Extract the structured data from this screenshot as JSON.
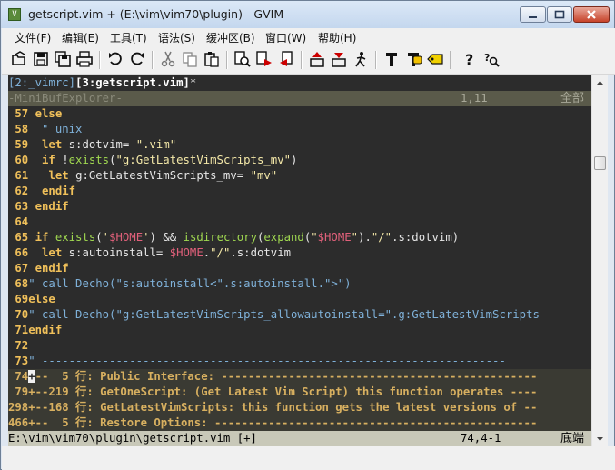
{
  "window": {
    "title": "getscript.vim + (E:\\vim\\vim70\\plugin) - GVIM",
    "app_icon": "vim-icon",
    "controls": [
      "minimize-icon",
      "maximize-icon",
      "close-icon"
    ]
  },
  "menu": [
    "文件(F)",
    "编辑(E)",
    "工具(T)",
    "语法(S)",
    "缓冲区(B)",
    "窗口(W)",
    "帮助(H)"
  ],
  "toolbar": {
    "icons": [
      "open-icon",
      "save-icon",
      "save-all-icon",
      "print-icon",
      "undo-icon",
      "redo-icon",
      "cut-icon",
      "copy-icon",
      "paste-icon",
      "find-replace-icon",
      "find-next-icon",
      "find-prev-icon",
      "load-session-icon",
      "save-session-icon",
      "run-script-icon",
      "make-icon",
      "run-shell-icon",
      "tag-jump-icon",
      "help-icon",
      "find-help-icon"
    ]
  },
  "minibuf": {
    "tab1": "[2:_vimrc]",
    "tab2": "[3:getscript.vim]",
    "modified": "*",
    "label": "-MiniBufExplorer-",
    "position": "1,11",
    "percent": "全部"
  },
  "lines": [
    {
      "n": "57",
      "text": " else"
    },
    {
      "n": "58",
      "text": "  \" unix"
    },
    {
      "n": "59",
      "text": "  let s:dotvim= \".vim\""
    },
    {
      "n": "60",
      "text": "  if !exists(\"g:GetLatestVimScripts_mv\")"
    },
    {
      "n": "61",
      "text": "   let g:GetLatestVimScripts_mv= \"mv\""
    },
    {
      "n": "62",
      "text": "  endif"
    },
    {
      "n": "63",
      "text": " endif"
    },
    {
      "n": "64",
      "text": ""
    },
    {
      "n": "65",
      "text": " if exists('$HOME') && isdirectory(expand(\"$HOME\").\"/\".s:dotvim)"
    },
    {
      "n": "66",
      "text": "  let s:autoinstall= $HOME.\"/\".s:dotvim"
    },
    {
      "n": "67",
      "text": " endif"
    },
    {
      "n": "68",
      "text": "\" call Decho(\"s:autoinstall<\".s:autoinstall.\">\")"
    },
    {
      "n": "69",
      "text": "else"
    },
    {
      "n": "70",
      "text": "\" call Decho(\"g:GetLatestVimScripts_allowautoinstall=\".g:GetLatestVimScripts"
    },
    {
      "n": "71",
      "text": "endif"
    },
    {
      "n": "72",
      "text": ""
    },
    {
      "n": "73",
      "text": "\" ---------------------------------------------------------------------"
    }
  ],
  "folds": [
    {
      "n": "74",
      "text": "+--  5 行: Public Interface: -----------------------------------------------"
    },
    {
      "n": "79",
      "text": "+--219 行: GetOneScript: (Get Latest Vim Script) this function operates ----"
    },
    {
      "n": "298",
      "text": "+--168 行: GetLatestVimScripts: this function gets the latest versions of --"
    },
    {
      "n": "466",
      "text": "+--  5 行: Restore Options: ------------------------------------------------"
    }
  ],
  "status": {
    "file": "E:\\vim\\vim70\\plugin\\getscript.vim [+]",
    "position": "74,4-1",
    "percent": "底端"
  }
}
